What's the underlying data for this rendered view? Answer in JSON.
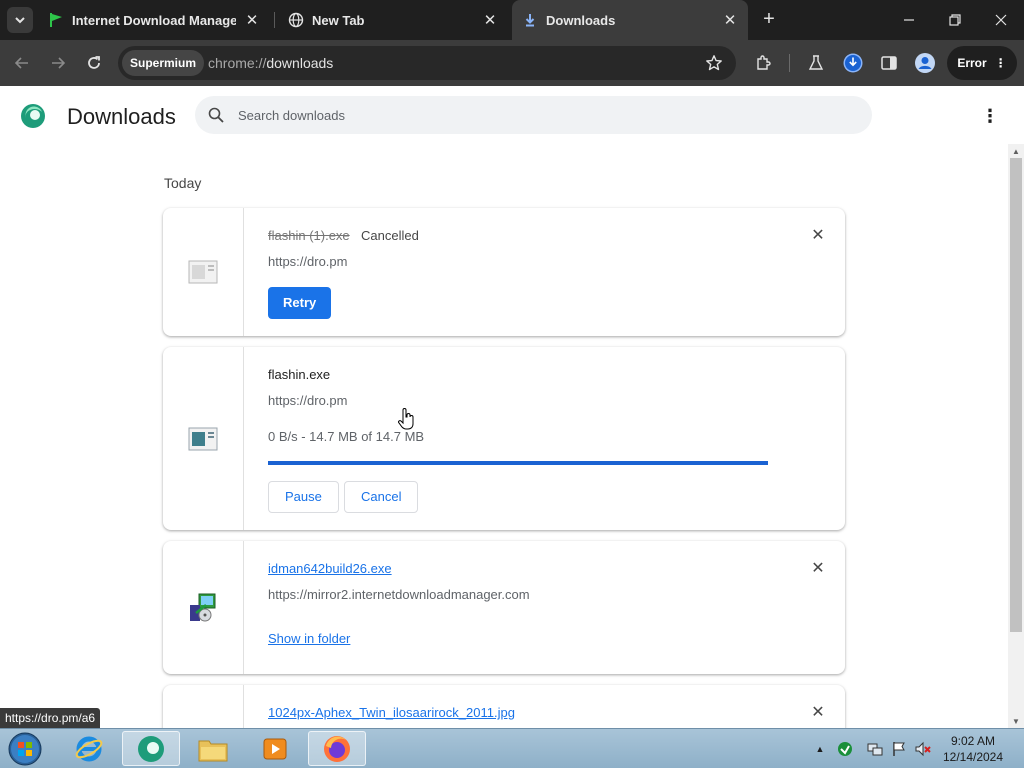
{
  "browser": {
    "tabs": [
      {
        "title": "Internet Download Manager is",
        "active": false,
        "favicon": "green-flag-icon"
      },
      {
        "title": "New Tab",
        "active": false,
        "favicon": "globe-icon"
      },
      {
        "title": "Downloads",
        "active": true,
        "favicon": "download-icon"
      }
    ],
    "omnibox": {
      "chip": "Supermium",
      "scheme": "chrome://",
      "path": "downloads"
    },
    "error_button": "Error"
  },
  "page": {
    "title": "Downloads",
    "search_placeholder": "Search downloads",
    "section_label": "Today",
    "downloads": [
      {
        "filename": "flashin (1).exe",
        "status": "Cancelled",
        "source": "https://dro.pm",
        "action": "Retry"
      },
      {
        "filename": "flashin.exe",
        "source": "https://dro.pm",
        "progress_text": "0 B/s - 14.7 MB of 14.7 MB",
        "progress_fraction": 1.0,
        "actions": [
          "Pause",
          "Cancel"
        ]
      },
      {
        "filename": "idman642build26.exe",
        "source": "https://mirror2.internetdownloadmanager.com",
        "action": "Show in folder"
      },
      {
        "filename": "1024px-Aphex_Twin_ilosaarirock_2011.jpg"
      }
    ],
    "status_tooltip": "https://dro.pm/a6"
  },
  "taskbar": {
    "items": [
      "start-orb",
      "internet-explorer",
      "supermium",
      "file-explorer",
      "media-player",
      "firefox"
    ],
    "clock_time": "9:02 AM",
    "clock_date": "12/14/2024"
  },
  "colors": {
    "accent": "#1a73e8",
    "progress": "#1a62d2",
    "tabstrip": "#1f1f1f",
    "toolbar": "#3c3c3c"
  }
}
